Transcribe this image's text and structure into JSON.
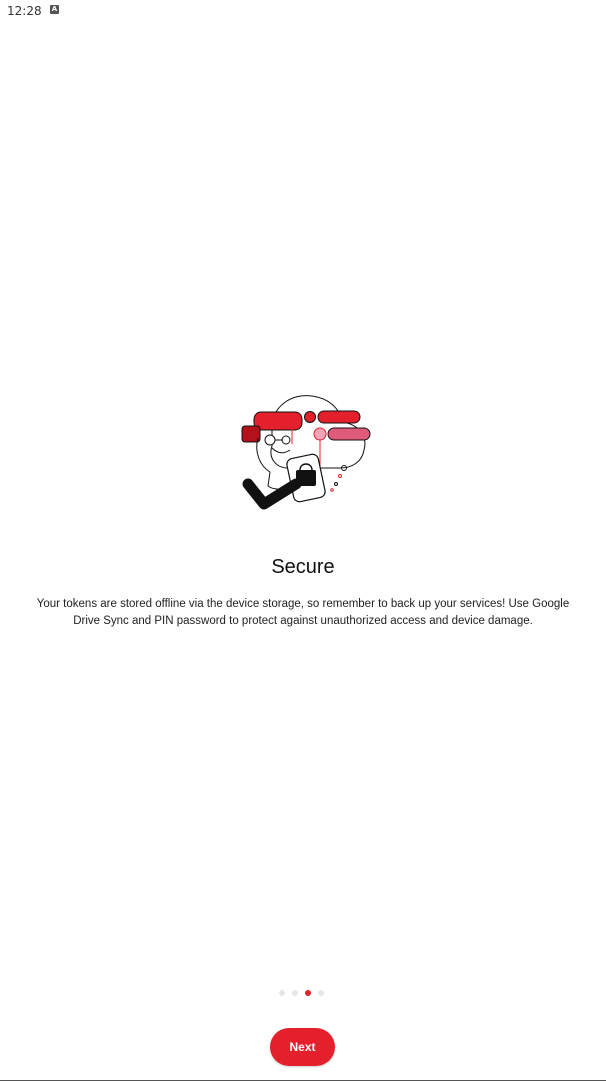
{
  "status_bar": {
    "time": "12:28",
    "notification_icon": "a-icon",
    "notification_glyph": "A"
  },
  "onboarding": {
    "illustration": "secure-lock-cloud-illustration",
    "title": "Secure",
    "description": "Your tokens are stored offline via the device storage, so remember to back up your services! Use Google Drive Sync and PIN password to protect against unauthorized access and device damage.",
    "page_indicator": {
      "total": 4,
      "current": 3
    },
    "next_label": "Next"
  },
  "colors": {
    "accent": "#e3202b",
    "inactive_dot": "#e6e6e6",
    "background": "#ffffff"
  }
}
